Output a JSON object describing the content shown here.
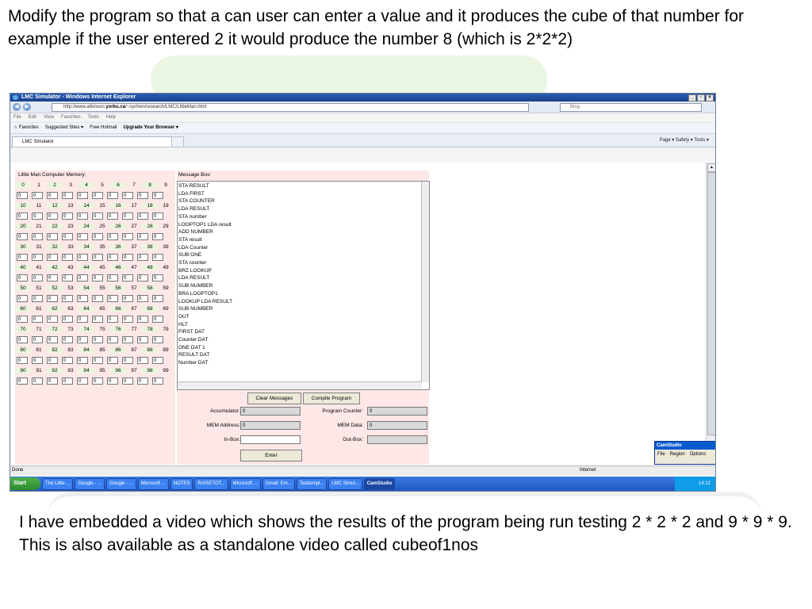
{
  "slide": {
    "top_text": "Modify the program so that a can user can enter a value and it produces the cube of that number for example if the user entered 2 it would produce the number 8 (which is 2*2*2)",
    "bottom_text": "I have embedded a video which shows the results of the program being run testing 2 * 2 * 2 and 9 * 9 * 9.  This is also available as a standalone video called cubeof1nos"
  },
  "browser": {
    "title": "LMC Simulator - Windows Internet Explorer",
    "url_prefix": "http://www.atkinson.",
    "url_domain": "yorku.ca",
    "url_rest": "/~sychen/research/LMC/LittleMan.html",
    "search_placeholder": "Bing",
    "menu": [
      "File",
      "Edit",
      "View",
      "Favorites",
      "Tools",
      "Help"
    ],
    "favorites_label": "Favorites",
    "favorites": [
      "Suggested Sites ▾",
      "Free Hotmail",
      "Upgrade Your Browser ▾"
    ],
    "tab_title": "LMC Simulator",
    "command_bar": "Page ▾   Safety ▾   Tools ▾",
    "status_left": "Done",
    "status_zone": "Internet"
  },
  "lmc": {
    "memory_title": "Little Man Computer Memory:",
    "message_title": "Message Box:",
    "messages": [
      "STA RESULT",
      "LDA FIRST",
      "STA COUNTER",
      "LDA RESULT",
      "STA number",
      "LOOPTOP1 LDA result",
      "ADD NUMBER",
      "STA result",
      "LDA Counter",
      "SUB ONE",
      "STA counter",
      "BRZ LOOKUP",
      "LDA RESULT",
      "SUB NUMBER",
      "BRA LOOPTOP1",
      "LOOKUP LDA RESULT",
      "SUB NUMBER",
      "OUT",
      "HLT",
      "FIRST DAT",
      "Counter DAT",
      "ONE DAT 1",
      "RESULT DAT",
      "Number DAT"
    ],
    "clear_button": "Clear Messages",
    "compile_button": "Compile Program",
    "enter_button": "Enter",
    "accumulator_label": "Accumulator:",
    "accumulator": "0",
    "program_counter_label": "Program Counter:",
    "program_counter": "0",
    "mem_address_label": "MEM Address:",
    "mem_address": "0",
    "mem_data_label": "MEM Data:",
    "mem_data": "0",
    "inbox_label": "In-Box:",
    "inbox": "",
    "outbox_label": "Out-Box:",
    "outbox": "",
    "cell_value": "0"
  },
  "camstudio": {
    "title": "CamStudio",
    "menu": [
      "File",
      "Region",
      "Options"
    ]
  },
  "taskbar": {
    "start": "Start",
    "tasks": [
      "The Little ...",
      "Google - ...",
      "Google - ...",
      "Microsoft ...",
      "NOTES",
      "RAISETOT...",
      "Microsoft ...",
      "Gmail: Em...",
      "Testtempl...",
      "LMC Simul...",
      "CamStudio"
    ],
    "clock": "14:12"
  }
}
